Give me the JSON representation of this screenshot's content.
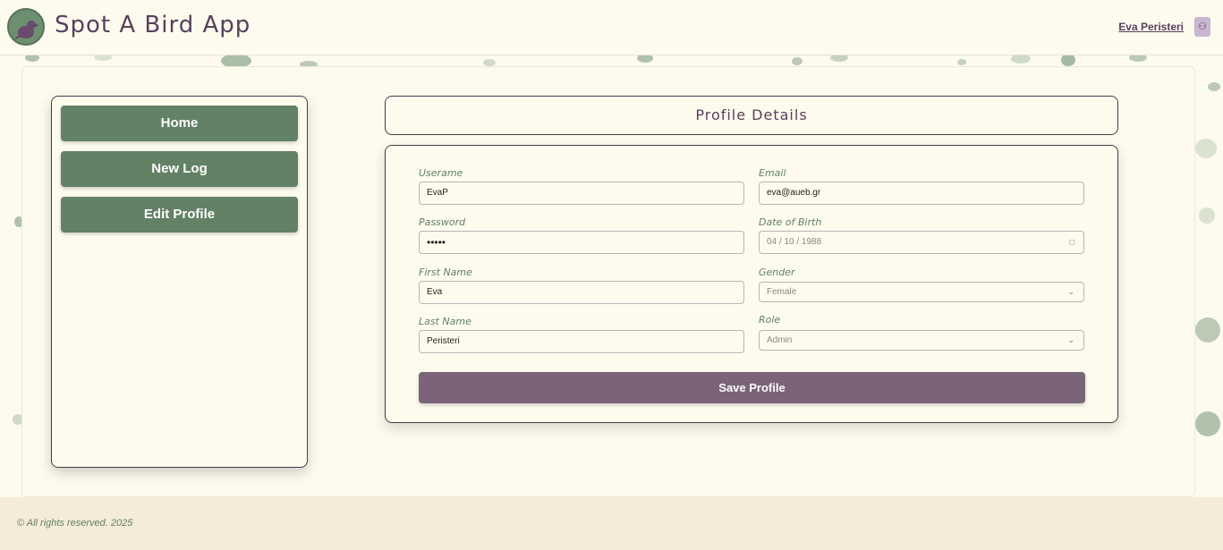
{
  "header": {
    "app_title": "Spot A Bird App",
    "logo_icon": "bird-logo-icon",
    "user_name": "Eva Peristeri",
    "user_icon": "user-icon"
  },
  "sidebar": {
    "items": [
      {
        "label": "Home"
      },
      {
        "label": "New Log"
      },
      {
        "label": "Edit Profile"
      }
    ]
  },
  "profile": {
    "title": "Profile Details",
    "fields": {
      "username": {
        "label": "Userame",
        "value": "EvaP"
      },
      "email": {
        "label": "Email",
        "value": "eva@aueb.gr"
      },
      "password": {
        "label": "Password",
        "value": "•••••"
      },
      "dob": {
        "label": "Date of Birth",
        "value": "04 / 10 / 1988"
      },
      "first_name": {
        "label": "First Name",
        "value": "Eva"
      },
      "gender": {
        "label": "Gender",
        "value": "Female"
      },
      "last_name": {
        "label": "Last Name",
        "value": "Peristeri"
      },
      "role": {
        "label": "Role",
        "value": "Admin"
      }
    },
    "save_label": "Save Profile"
  },
  "footer": {
    "text": "© All rights reserved. 2025"
  },
  "colors": {
    "background": "#fdfbed",
    "nav_button": "#628165",
    "save_button": "#7b6479",
    "title_text": "#5a3f5e",
    "footer_bg": "#f4ebd8"
  }
}
